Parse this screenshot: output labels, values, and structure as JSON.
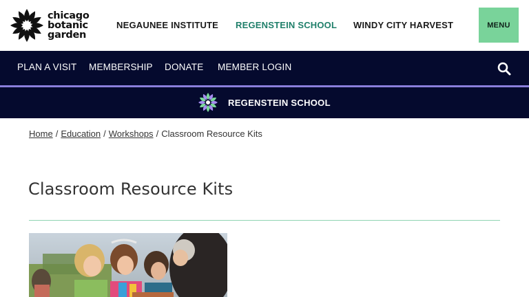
{
  "logo": {
    "lines": [
      "chicago",
      "botanic",
      "garden"
    ]
  },
  "top_nav": {
    "items": [
      {
        "label": "NEGAUNEE INSTITUTE"
      },
      {
        "label": "REGENSTEIN SCHOOL",
        "active": true
      },
      {
        "label": "WINDY CITY HARVEST"
      }
    ],
    "menu_label": "MENU"
  },
  "main_nav": {
    "items": [
      {
        "label": "PLAN A VISIT"
      },
      {
        "label": "MEMBERSHIP"
      },
      {
        "label": "DONATE"
      },
      {
        "label": "MEMBER LOGIN"
      }
    ],
    "search_icon": "search-icon"
  },
  "sub_nav": {
    "label": "REGENSTEIN SCHOOL",
    "icon": "flower-icon"
  },
  "breadcrumb": {
    "items": [
      "Home",
      "Education",
      "Workshops"
    ],
    "current": "Classroom Resource Kits",
    "separator": "/"
  },
  "page": {
    "title": "Classroom Resource Kits"
  },
  "colors": {
    "nav_bg": "#050a2e",
    "accent_green": "#79d39a",
    "active_link": "#1f7f6a",
    "accent_line": "#8a7fdc",
    "divider": "#8fd4b2"
  }
}
